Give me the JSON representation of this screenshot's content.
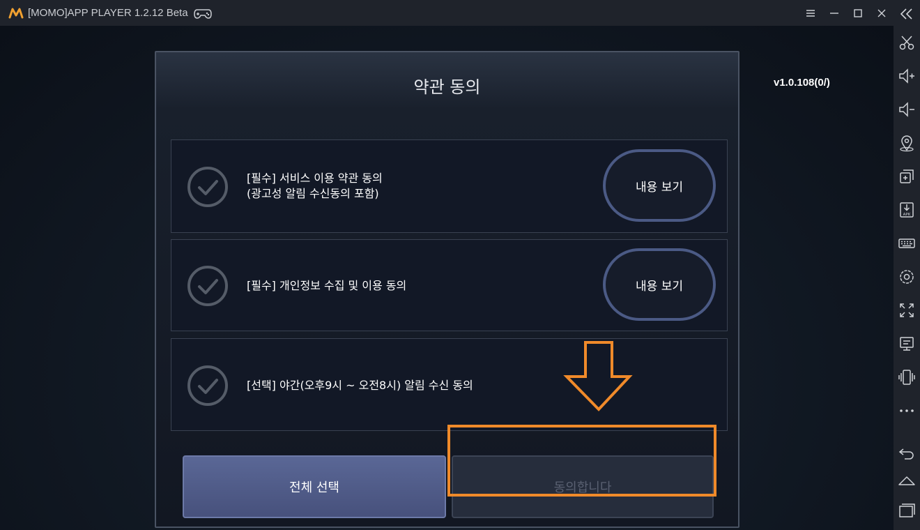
{
  "window": {
    "title": "[MOMO]APP PLAYER 1.2.12 Beta",
    "controls": [
      "menu-icon",
      "minimize-icon",
      "maximize-icon",
      "close-icon"
    ]
  },
  "game": {
    "version": "v1.0.108(0/)"
  },
  "dialog": {
    "title": "약관 동의",
    "items": [
      {
        "line1": "[필수] 서비스 이용 약관 동의",
        "line2": "(광고성 알림 수신동의 포함)",
        "button": "내용 보기"
      },
      {
        "line1": "[필수] 개인정보 수집 및 이용 동의",
        "button": "내용 보기"
      },
      {
        "line1": "[선택] 야간(오후9시 ~ 오전8시) 알림 수신 동의"
      }
    ],
    "select_all": "전체 선택",
    "agree": "동의합니다"
  },
  "sidebar": {
    "icons": [
      "collapse-icon",
      "scissors-icon",
      "volume-up-icon",
      "volume-down-icon",
      "location-icon",
      "multi-instance-icon",
      "apk-install-icon",
      "keyboard-icon",
      "settings-icon",
      "fullscreen-icon",
      "screen-icon",
      "shake-icon",
      "more-icon",
      "back-icon",
      "home-icon",
      "recent-apps-icon"
    ]
  },
  "colors": {
    "annotation": "#f08a2a",
    "select_all_bg": "#5a6796",
    "view_btn_border": "#4b5a85",
    "logo": "#f0a030"
  }
}
